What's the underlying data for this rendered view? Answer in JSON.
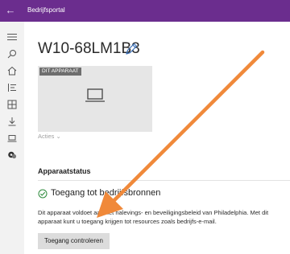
{
  "titlebar": {
    "title": "Bedrijfsportal",
    "back_icon": "arrow-left-icon"
  },
  "nav_rail": {
    "items": [
      {
        "name": "hamburger-menu-icon"
      },
      {
        "name": "search-icon"
      },
      {
        "name": "home-icon"
      },
      {
        "name": "apps-list-icon"
      },
      {
        "name": "app-categories-icon"
      },
      {
        "name": "download-icon"
      },
      {
        "name": "devices-icon"
      },
      {
        "name": "support-icon"
      }
    ]
  },
  "device": {
    "name": "W10-68LM1B3",
    "edit_icon": "pencil-icon",
    "badge": "DIT APPARAAT",
    "image_icon": "laptop-icon",
    "actions_label": "Acties ⌄"
  },
  "status": {
    "heading": "Apparaatstatus",
    "access_title": "Toegang tot bedrijfsbronnen",
    "description": "Dit apparaat voldoet aan het nalevings- en beveiligingsbeleid van Philadelphia. Met dit apparaat kunt u toegang krijgen tot resources zoals bedrijfs-e-mail.",
    "check_button": "Toegang controleren"
  },
  "colors": {
    "titlebar_bg": "#6b2d8e",
    "check_green": "#2e8b3d",
    "arrow_orange": "#f0893a"
  }
}
